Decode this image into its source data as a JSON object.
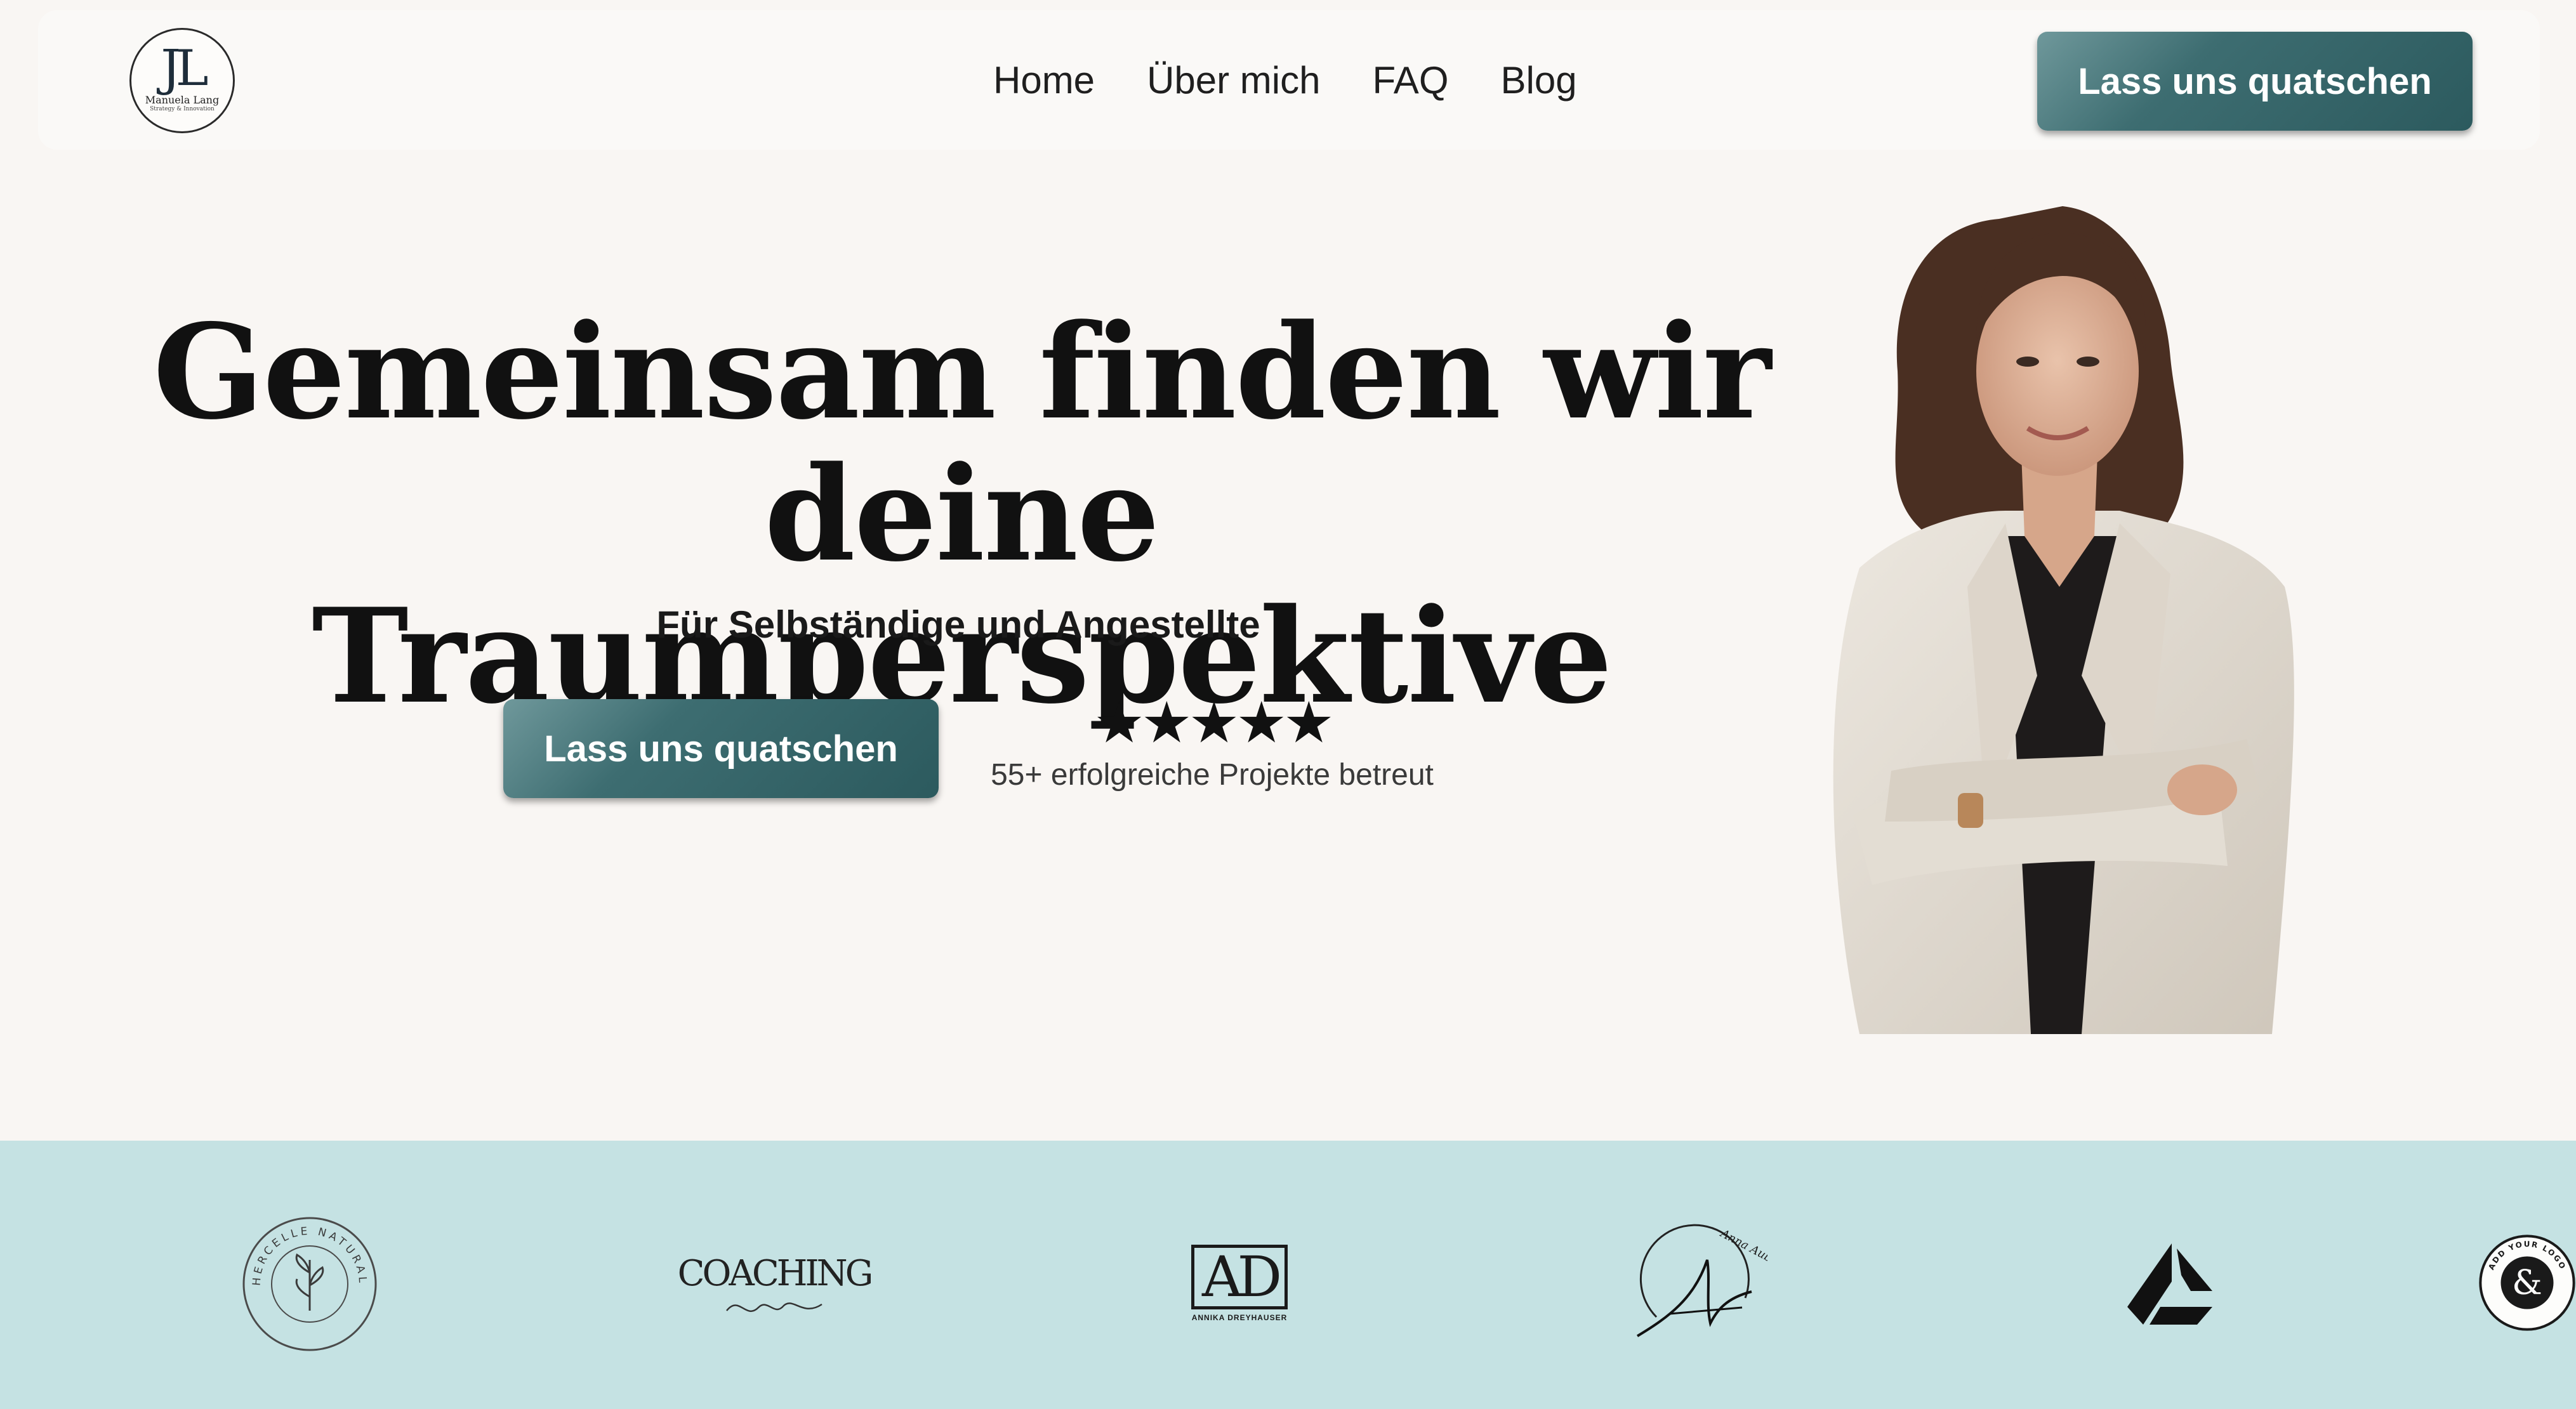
{
  "logo": {
    "monogram": "JL",
    "name": "Manuela Lang",
    "tagline": "Strategy & Innovation"
  },
  "nav": {
    "items": [
      "Home",
      "Über mich",
      "FAQ",
      "Blog"
    ]
  },
  "header": {
    "cta_label": "Lass uns quatschen"
  },
  "hero": {
    "title_line1": "Gemeinsam finden wir deine",
    "title_line2": "Traumperspektive",
    "subtitle": "Für Selbständige und Angestellte",
    "cta_label": "Lass uns quatschen",
    "stars": "★★★★★",
    "rating_value": 5,
    "rating_text": "55+ erfolgreiche Projekte betreut"
  },
  "client_logos": [
    {
      "icon": "herbal-wreath-logo",
      "text": "HERCELLE NATURAL"
    },
    {
      "icon": "coaching-script-logo",
      "text": "COACHING"
    },
    {
      "icon": "ad-monogram-logo",
      "text": "ANNIKA DREYHAUSER",
      "mark": "AD"
    },
    {
      "icon": "signature-a-logo",
      "text": "Anna Aubenger",
      "mark": "A"
    },
    {
      "icon": "geometric-mark-logo",
      "text": ""
    },
    {
      "icon": "circle-badge-logo",
      "text": "ADD YOUR LOGO"
    }
  ],
  "colors": {
    "accent": "#2c5a5e",
    "page_bg": "#f9f6f3",
    "strip_bg": "#c5e2e3"
  }
}
